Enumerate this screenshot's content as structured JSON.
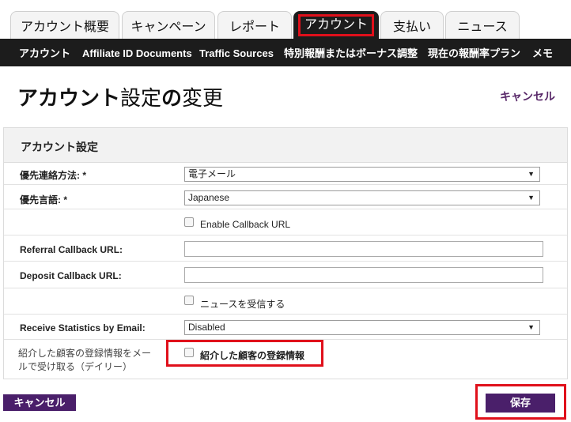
{
  "tabs": [
    "アカウント概要",
    "キャンペーン",
    "レポート",
    "アカウント",
    "支払い",
    "ニュース"
  ],
  "subnav": [
    "アカウント",
    "Affiliate ID Documents",
    "Traffic Sources",
    "特別報酬またはボーナス調整",
    "現在の報酬率プラン",
    "メモ"
  ],
  "page": {
    "title_bold": "アカウント",
    "title_rest": "設定",
    "title_particle": "の",
    "title_end": "変更",
    "cancel_link": "キャンセル"
  },
  "form": {
    "heading": "アカウント設定",
    "contact_label": "優先連絡方法: *",
    "contact_value": "電子メール",
    "language_label": "優先言語: *",
    "language_value": "Japanese",
    "callback_checkbox": "Enable Callback URL",
    "referral_label": "Referral Callback URL:",
    "deposit_label": "Deposit Callback URL:",
    "news_checkbox": "ニュースを受信する",
    "stats_label": "Receive Statistics by Email:",
    "stats_value": "Disabled",
    "referred_label_1": "紹介した顧客の登録情報をメー",
    "referred_label_2": "ルで受け取る（デイリー）",
    "referred_checkbox": "紹介した顧客の登録情報"
  },
  "buttons": {
    "cancel": "キャンセル",
    "save": "保存"
  },
  "colors": {
    "highlight": "#e0101b",
    "nav": "#1c1c1c",
    "button": "#4a1f6a"
  }
}
